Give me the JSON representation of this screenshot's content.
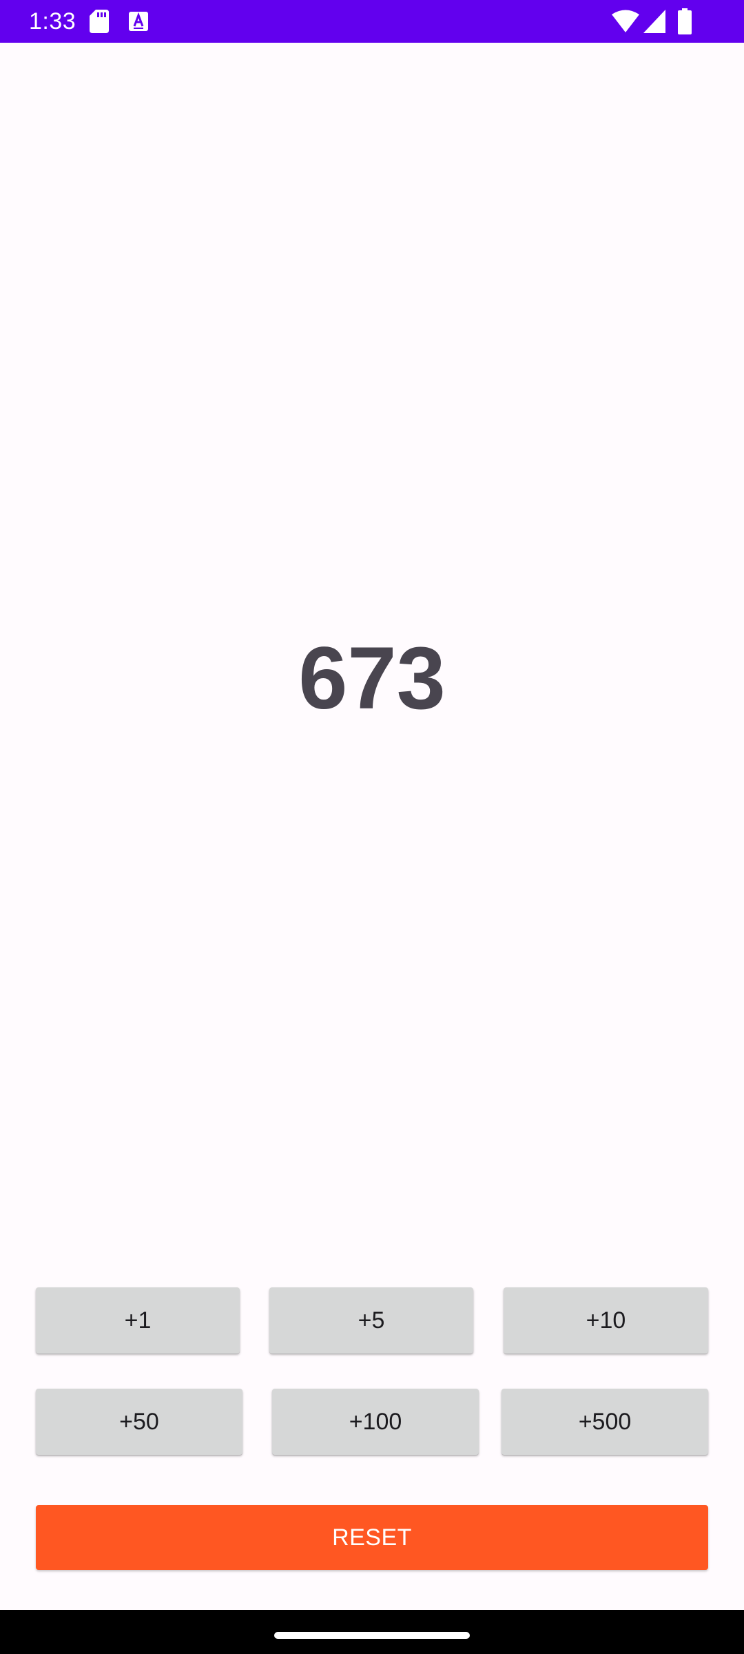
{
  "status_bar": {
    "time": "1:33",
    "left_icons": [
      "sd-card-icon",
      "keyboard-a-icon"
    ],
    "right_icons": [
      "wifi-icon",
      "signal-icon",
      "battery-icon"
    ],
    "background": "#6200EE"
  },
  "counter": {
    "value": "673"
  },
  "increment_buttons": [
    {
      "label": "+1"
    },
    {
      "label": "+5"
    },
    {
      "label": "+10"
    },
    {
      "label": "+50"
    },
    {
      "label": "+100"
    },
    {
      "label": "+500"
    }
  ],
  "reset_button": {
    "label": "RESET",
    "color": "#FF5722"
  },
  "colors": {
    "background": "#FFFBFE",
    "button_grey": "#D6D7D7",
    "counter_text": "#49454F"
  }
}
